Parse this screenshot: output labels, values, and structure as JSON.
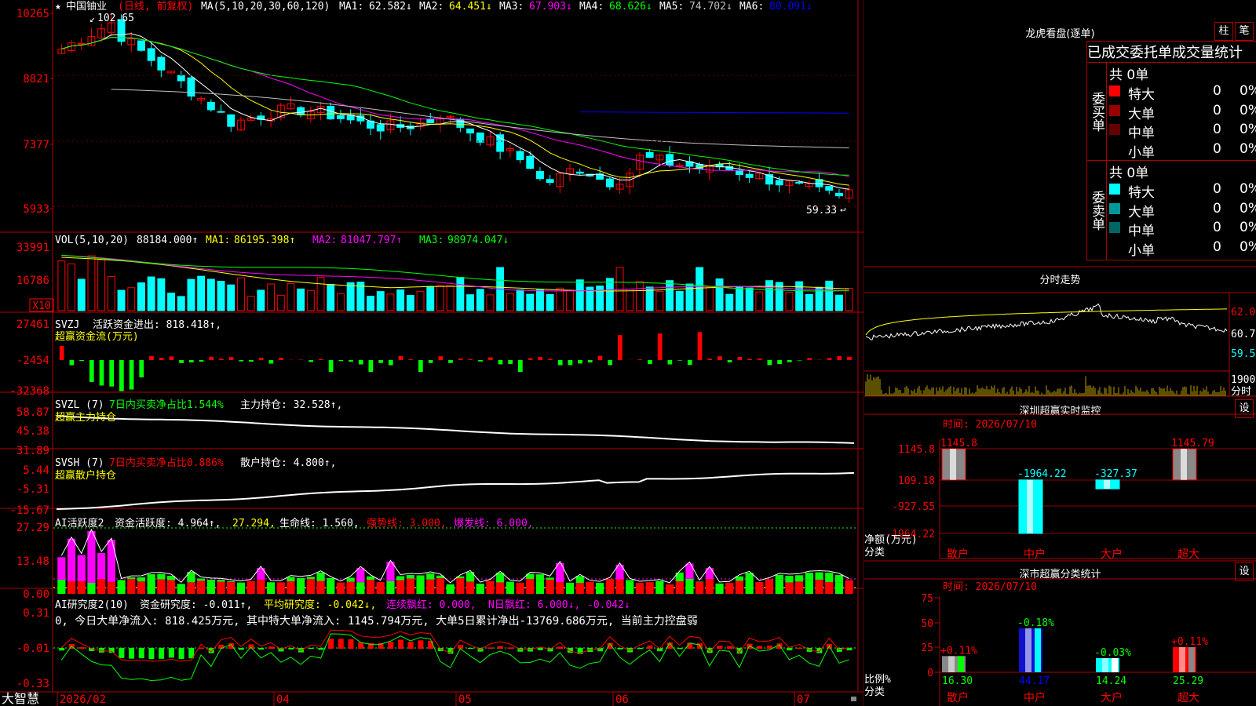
{
  "app": {
    "name": "大智慧"
  },
  "main_chart": {
    "title_star": "★",
    "stock": "中国铀业",
    "mode": "(日线, 前复权)",
    "ma_label": "MA(5,10,20,30,60,120)",
    "ma_values": [
      {
        "label": "MA1:",
        "value": "62.582↓",
        "color": "#ffffff"
      },
      {
        "label": "MA2:",
        "value": "64.451↓",
        "color": "#ffff00"
      },
      {
        "label": "MA3:",
        "value": "67.903↓",
        "color": "#ff00ff"
      },
      {
        "label": "MA4:",
        "value": "68.626↓",
        "color": "#00ff00"
      },
      {
        "label": "MA5:",
        "value": "74.702↓",
        "color": "#c0c0c0"
      },
      {
        "label": "MA6:",
        "value": "80.091↓",
        "color": "#0000ff"
      }
    ],
    "y_ticks": [
      "10265",
      "8821",
      "7377",
      "5933"
    ],
    "high_label": "102.65",
    "low_label": "59.33"
  },
  "vol_panel": {
    "label": "VOL(5,10,20)",
    "value": "88184.000↑",
    "items": [
      {
        "label": "MA1:",
        "value": "86195.398↑",
        "color": "#ffff00"
      },
      {
        "label": "MA2:",
        "value": "81047.797↑",
        "color": "#ff00ff"
      },
      {
        "label": "MA3:",
        "value": "98974.047↓",
        "color": "#00ff00"
      }
    ],
    "y_ticks": [
      "33991",
      "16786"
    ],
    "unit": "X10"
  },
  "svzj_panel": {
    "label": "SVZJ",
    "text1": "活跃资金进出: 818.418↑,",
    "text2": "超赢资金流(万元)",
    "y_ticks": [
      "27461",
      "-2454",
      "-32368"
    ]
  },
  "svzl_panel": {
    "label": "SVZL (7)",
    "text1": "7日内买卖净占比1.544%",
    "text2": "主力持仓: 32.528↑,",
    "text3": "超赢主力持仓",
    "y_ticks": [
      "58.87",
      "45.38",
      "31.89"
    ]
  },
  "svsh_panel": {
    "label": "SVSH (7)",
    "text1": "7日内买卖净占比0.886%",
    "text2": "散户持仓: 4.800↑,",
    "text3": "超赢散户持仓",
    "y_ticks": [
      "5.44",
      "-5.31",
      "-15.67"
    ]
  },
  "ai_act_panel": {
    "label": "AI活跃度2",
    "text1": "资金活跃度: 4.964↑,",
    "text2": "27.294,",
    "text3": "生命线: 1.560,",
    "text4": "强势线: 3.000,",
    "text5": "爆发线: 6.000,",
    "y_ticks": [
      "27.29",
      "13.48",
      "0.00"
    ]
  },
  "ai_res_panel": {
    "label": "AI研究度2(10)",
    "text1": "资金研究度: -0.011↑,",
    "text2": "平均研究度: -0.042↓,",
    "text3": "连续飘红: 0.000,",
    "text4": "N日飘红: 6.000↓,",
    "text5": "-0.042↓",
    "summary": "0, 今日大单净流入: 818.425万元, 其中特大单净流入: 1145.794万元, 大单5日累计净出-13769.686万元, 当前主力控盘弱",
    "y_ticks": [
      "0.31",
      "-0.01",
      "-0.33"
    ]
  },
  "x_axis": {
    "labels": [
      "2026/02",
      "04",
      "05",
      "06",
      "07"
    ]
  },
  "dragon": {
    "title": "龙虎看盘(逐单)",
    "btn_bar": "柱",
    "btn_pen": "笔",
    "header": "已成交委托单成交量统计",
    "buy": {
      "side": "委买单",
      "total": "共 0单",
      "rows": [
        {
          "label": "特大",
          "count": "0",
          "pct": "0%",
          "color": "#ff0000"
        },
        {
          "label": "大单",
          "count": "0",
          "pct": "0%",
          "color": "#990000"
        },
        {
          "label": "中单",
          "count": "0",
          "pct": "0%",
          "color": "#660000"
        },
        {
          "label": "小单",
          "count": "0",
          "pct": "0%",
          "color": "#000000"
        }
      ]
    },
    "sell": {
      "side": "委卖单",
      "total": "共 0单",
      "rows": [
        {
          "label": "特大",
          "count": "0",
          "pct": "0%",
          "color": "#00ffff"
        },
        {
          "label": "大单",
          "count": "0",
          "pct": "0%",
          "color": "#009999"
        },
        {
          "label": "中单",
          "count": "0",
          "pct": "0%",
          "color": "#006666"
        },
        {
          "label": "小单",
          "count": "0",
          "pct": "0%",
          "color": "#000000"
        }
      ]
    }
  },
  "intraday": {
    "title": "分时走势",
    "y_ticks": [
      "62.06",
      "60.79",
      "59.53"
    ],
    "vol_tick": "1900",
    "vol_label": "分时"
  },
  "monitor": {
    "title": "深圳超赢实时监控",
    "btn": "设",
    "time": "时间: 2026/07/10",
    "y_ticks": [
      "1145.8",
      "109.18",
      "-927.55",
      "-1964.22"
    ],
    "ylabel": "净额(万元)",
    "xlabel": "分类",
    "bars": [
      {
        "cat": "散户",
        "value": 1145.8,
        "label": "1145.8"
      },
      {
        "cat": "中户",
        "value": -1964.22,
        "label": "-1964.22"
      },
      {
        "cat": "大户",
        "value": -327.37,
        "label": "-327.37"
      },
      {
        "cat": "超大",
        "value": 1145.79,
        "label": "1145.79"
      }
    ]
  },
  "classify": {
    "title": "深市超赢分类统计",
    "btn": "设",
    "time": "时间: 2026/07/10",
    "y_ticks": [
      "75",
      "50",
      "25",
      "0"
    ],
    "ylabel": "比例%",
    "xlabel": "分类",
    "bars": [
      {
        "cat": "散户",
        "value": 16.3,
        "top": "+0.11%",
        "bottom": "16.30"
      },
      {
        "cat": "中户",
        "value": 44.17,
        "top": "-0.18%",
        "bottom": "44.17"
      },
      {
        "cat": "大户",
        "value": 14.24,
        "top": "-0.03%",
        "bottom": "14.24"
      },
      {
        "cat": "超大",
        "value": 25.29,
        "top": "+0.11%",
        "bottom": "25.29"
      }
    ]
  },
  "colors": {
    "up": "#ff0000",
    "down": "#00ffff",
    "frame": "#b00000",
    "green": "#00ff00",
    "magenta": "#ff00ff",
    "yellow": "#ffff00"
  }
}
